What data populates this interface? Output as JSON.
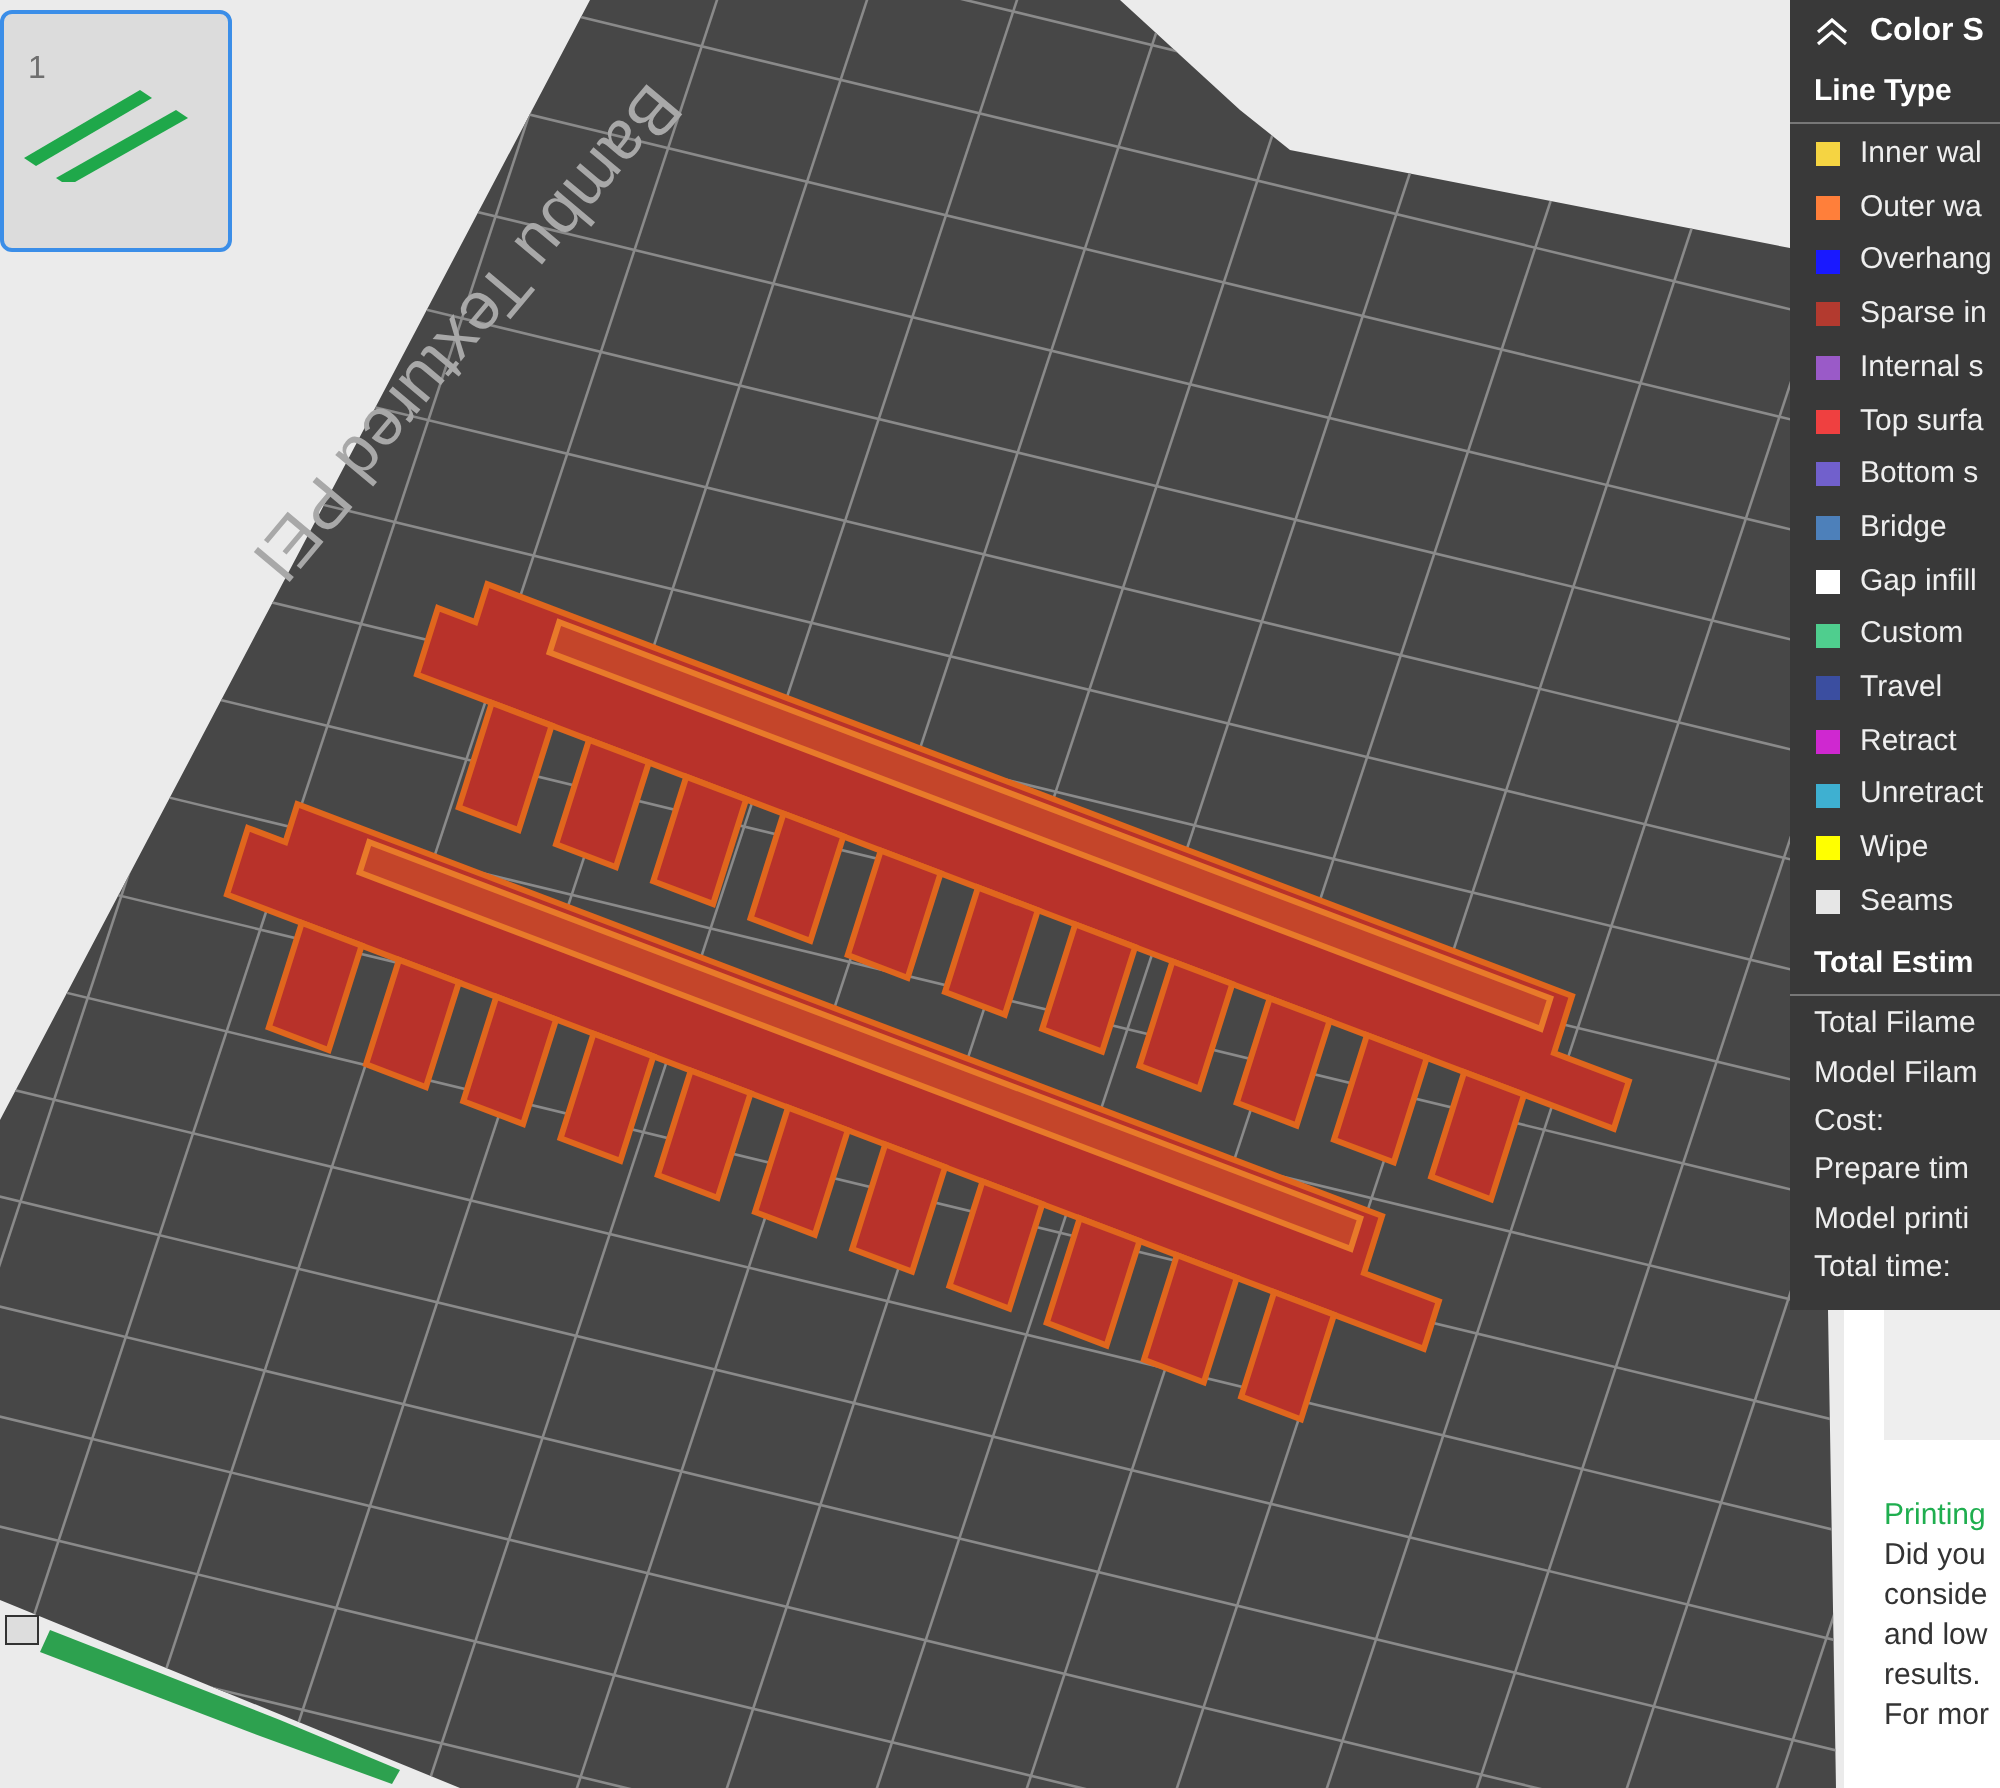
{
  "plate_thumbnails": [
    {
      "label": "1",
      "selected": true
    }
  ],
  "plate": {
    "label": "Bambu Textured PEI"
  },
  "legend": {
    "title": "Color S",
    "section": "Line Type",
    "items": [
      {
        "label": "Inner wal",
        "color": "#f5d442"
      },
      {
        "label": "Outer wa",
        "color": "#ff7f3a"
      },
      {
        "label": "Overhang",
        "color": "#1919ff"
      },
      {
        "label": "Sparse in",
        "color": "#b33a2f"
      },
      {
        "label": "Internal s",
        "color": "#9a5ac8"
      },
      {
        "label": "Top surfa",
        "color": "#ef4040"
      },
      {
        "label": "Bottom s",
        "color": "#7160cc"
      },
      {
        "label": "Bridge",
        "color": "#4d80ba"
      },
      {
        "label": "Gap infill",
        "color": "#ffffff"
      },
      {
        "label": "Custom",
        "color": "#4fce8e"
      },
      {
        "label": "Travel",
        "color": "#3b4ea0"
      },
      {
        "label": "Retract",
        "color": "#cf28d0"
      },
      {
        "label": "Unretract",
        "color": "#3eb0d1"
      },
      {
        "label": "Wipe",
        "color": "#ffff00"
      },
      {
        "label": "Seams",
        "color": "#e6e6e6"
      }
    ]
  },
  "estimate": {
    "title": "Total Estim",
    "rows": [
      "Total Filame",
      "Model Filam",
      "Cost:",
      "Prepare tim",
      "Model printi",
      "Total time:"
    ]
  },
  "tip": {
    "title": "Printing",
    "lines": [
      "Did you",
      "conside",
      "and low",
      "results.",
      "For mor"
    ]
  }
}
